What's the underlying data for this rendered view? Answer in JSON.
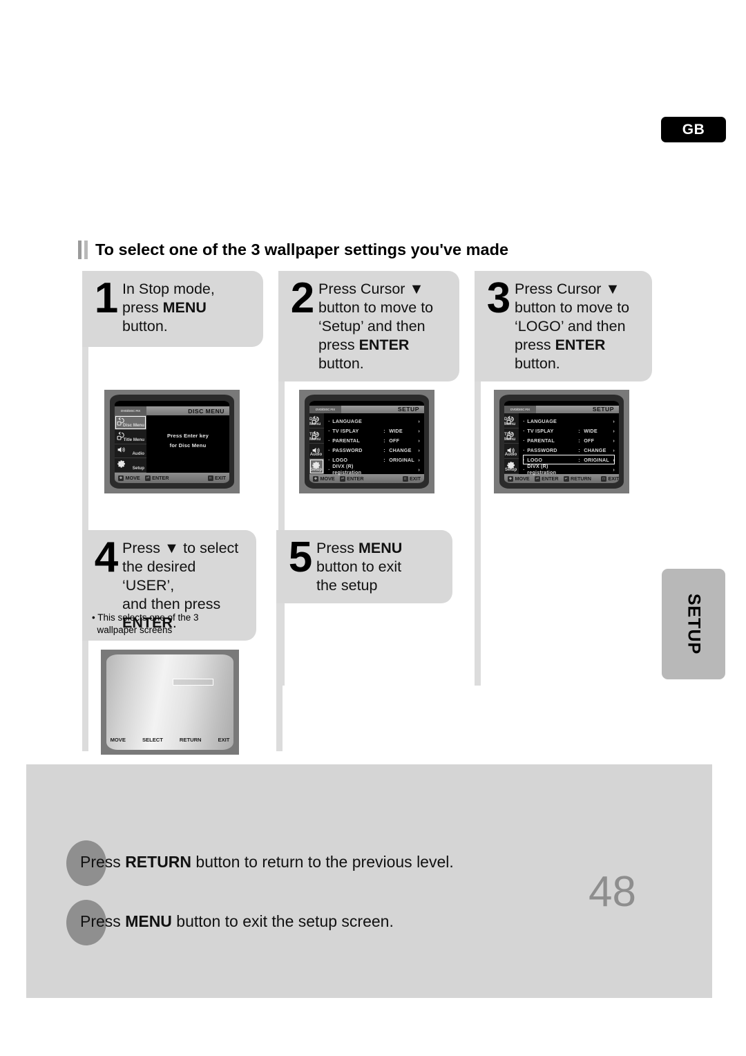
{
  "region_badge": {
    "label": "GB"
  },
  "side_tab": {
    "label": "SETUP"
  },
  "heading": {
    "title": "To select one of the 3 wallpaper settings you've made"
  },
  "steps": [
    {
      "number": "1",
      "lines": [
        [
          {
            "t": "In Stop mode,",
            "b": false
          }
        ],
        [
          {
            "t": "press ",
            "b": false
          },
          {
            "t": "MENU",
            "b": true
          }
        ],
        [
          {
            "t": "button.",
            "b": false
          }
        ]
      ]
    },
    {
      "number": "2",
      "lines": [
        [
          {
            "t": "Press Cursor ▼",
            "b": false
          }
        ],
        [
          {
            "t": "button to move to",
            "b": false
          }
        ],
        [
          {
            "t": "‘Setup’ and then",
            "b": false
          }
        ],
        [
          {
            "t": "press ",
            "b": false
          },
          {
            "t": "ENTER",
            "b": true
          },
          {
            "t": " button.",
            "b": false
          }
        ]
      ]
    },
    {
      "number": "3",
      "lines": [
        [
          {
            "t": "Press Cursor ▼",
            "b": false
          }
        ],
        [
          {
            "t": "button to move to",
            "b": false
          }
        ],
        [
          {
            "t": "‘LOGO’ and then",
            "b": false
          }
        ],
        [
          {
            "t": "press ",
            "b": false
          },
          {
            "t": "ENTER",
            "b": true
          },
          {
            "t": " button.",
            "b": false
          }
        ]
      ]
    },
    {
      "number": "4",
      "lines": [
        [
          {
            "t": "Press ▼ to select",
            "b": false
          }
        ],
        [
          {
            "t": "the desired ‘USER’,",
            "b": false
          }
        ],
        [
          {
            "t": "and then press",
            "b": false
          }
        ],
        [
          {
            "t": "ENTER",
            "b": true
          },
          {
            "t": ".",
            "b": false
          }
        ]
      ],
      "note": "• This selects one of the 3\n   wallpaper screens"
    },
    {
      "number": "5",
      "lines": [
        [
          {
            "t": "Press ",
            "b": false
          },
          {
            "t": "MENU",
            "b": true
          }
        ],
        [
          {
            "t": "button to exit",
            "b": false
          }
        ],
        [
          {
            "t": "the setup",
            "b": false
          }
        ]
      ]
    }
  ],
  "screens": {
    "disc_menu": {
      "tag": "DVD/DISC FIX",
      "title": "DISC MENU",
      "sidebar": [
        {
          "label": "Disc Menu",
          "icon": "disc-menu-icon",
          "selected": true
        },
        {
          "label": "Title Menu",
          "icon": "title-menu-icon",
          "selected": false
        },
        {
          "label": "Audio",
          "icon": "speaker-icon",
          "selected": false
        },
        {
          "label": "Setup",
          "icon": "gear-icon",
          "selected": false
        }
      ],
      "message_lines": [
        "Press Enter key",
        "for Disc Menu"
      ],
      "footer": [
        {
          "key": "✥",
          "label": "MOVE"
        },
        {
          "key": "⏎",
          "label": "ENTER"
        },
        {
          "key": "□",
          "label": "EXIT"
        }
      ]
    },
    "setup_menu": {
      "tag": "DVD/DISC FIX",
      "title": "SETUP",
      "sidebar": [
        {
          "label": "Disc Menu",
          "icon": "disc-menu-icon",
          "selected": false
        },
        {
          "label": "Title Menu",
          "icon": "title-menu-icon",
          "selected": false
        },
        {
          "label": "Audio",
          "icon": "speaker-icon",
          "selected": false
        },
        {
          "label": "Setup",
          "icon": "gear-icon",
          "selected": true
        }
      ],
      "rows": [
        {
          "name": "LANGUAGE",
          "value": "",
          "has_colon": false,
          "selected": false
        },
        {
          "name": "TV  ISPLAY",
          "value": "WIDE",
          "has_colon": true,
          "selected": false
        },
        {
          "name": "PARENTAL",
          "value": "OFF",
          "has_colon": true,
          "selected": false
        },
        {
          "name": "PASSWORD",
          "value": "CHANGE",
          "has_colon": true,
          "selected": false
        },
        {
          "name": "LOGO",
          "value": "ORIGINAL",
          "has_colon": true,
          "selected": false
        },
        {
          "name": "DIVX (R) registration",
          "value": "",
          "has_colon": false,
          "selected": false
        }
      ],
      "footer": [
        {
          "key": "✥",
          "label": "MOVE"
        },
        {
          "key": "⏎",
          "label": "ENTER"
        },
        {
          "key": "□",
          "label": "EXIT"
        }
      ]
    },
    "logo_selected": {
      "tag": "DVD/DISC FIX",
      "title": "SETUP",
      "sidebar": [
        {
          "label": "Disc Menu",
          "icon": "disc-menu-icon",
          "selected": false
        },
        {
          "label": "Title Menu",
          "icon": "title-menu-icon",
          "selected": false
        },
        {
          "label": "Audio",
          "icon": "speaker-icon",
          "selected": false
        },
        {
          "label": "Setup",
          "icon": "gear-icon",
          "selected": false
        }
      ],
      "rows": [
        {
          "name": "LANGUAGE",
          "value": "",
          "has_colon": false,
          "selected": false
        },
        {
          "name": "TV  ISPLAY",
          "value": "WIDE",
          "has_colon": true,
          "selected": false
        },
        {
          "name": "PARENTAL",
          "value": "OFF",
          "has_colon": true,
          "selected": false
        },
        {
          "name": "PASSWORD",
          "value": "CHANGE",
          "has_colon": true,
          "selected": false
        },
        {
          "name": "LOGO",
          "value": "ORIGINAL",
          "has_colon": true,
          "selected": true
        },
        {
          "name": "DIVX (R) registration",
          "value": "",
          "has_colon": false,
          "selected": false
        }
      ],
      "footer": [
        {
          "key": "✥",
          "label": "MOVE"
        },
        {
          "key": "⏎",
          "label": "ENTER"
        },
        {
          "key": "↵",
          "label": "RETURN"
        },
        {
          "key": "□",
          "label": "EXIT"
        }
      ]
    },
    "wallpaper": {
      "footer": [
        "MOVE",
        "SELECT",
        "RETURN",
        "EXIT"
      ]
    }
  },
  "bottom_notes": [
    [
      {
        "t": "Press ",
        "b": false
      },
      {
        "t": "RETURN",
        "b": true
      },
      {
        "t": " button to return to the previous level.",
        "b": false
      }
    ],
    [
      {
        "t": "Press ",
        "b": false
      },
      {
        "t": "MENU",
        "b": true
      },
      {
        "t": " button to exit the setup screen.",
        "b": false
      }
    ]
  ],
  "page_number": "48"
}
